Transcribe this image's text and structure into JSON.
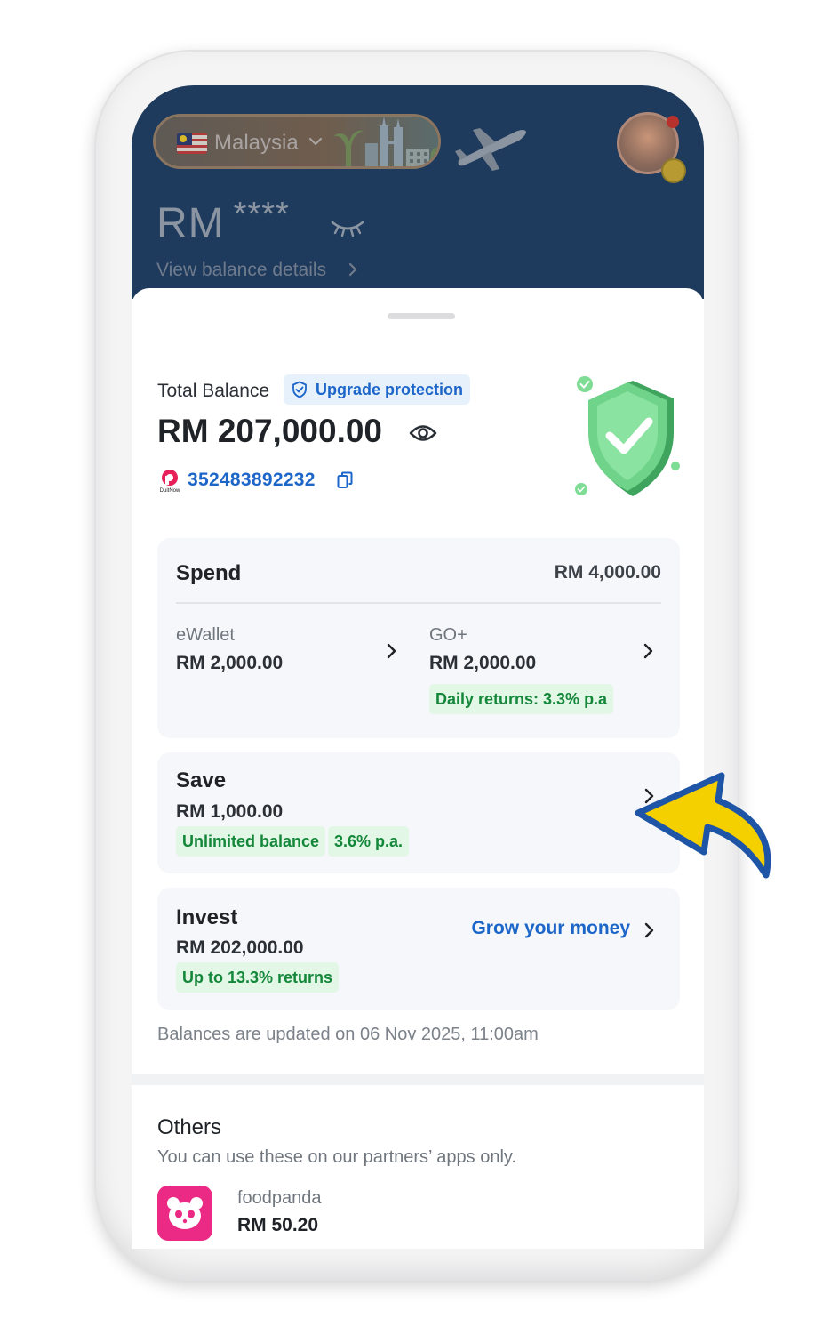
{
  "header": {
    "country": "Malaysia",
    "balance_currency": "RM",
    "balance_masked": "****",
    "view_balance_details": "View balance details"
  },
  "total": {
    "label": "Total Balance",
    "upgrade_label": "Upgrade protection",
    "value": "RM 207,000.00",
    "account_number": "352483892232",
    "duitnow_label": "DuitNow"
  },
  "spend": {
    "title": "Spend",
    "amount": "RM 4,000.00",
    "ewallet": {
      "label": "eWallet",
      "value": "RM 2,000.00"
    },
    "goplus": {
      "label": "GO+",
      "value": "RM 2,000.00",
      "tag": "Daily returns: 3.3% p.a"
    }
  },
  "save": {
    "title": "Save",
    "value": "RM 1,000.00",
    "tags": [
      "Unlimited balance",
      "3.6% p.a."
    ]
  },
  "invest": {
    "title": "Invest",
    "value": "RM 202,000.00",
    "tag": "Up to 13.3% returns",
    "cta": "Grow your money"
  },
  "updated_note": "Balances are updated on 06 Nov 2025, 11:00am",
  "others": {
    "title": "Others",
    "subtitle": "You can use these on our partners’ apps only.",
    "items": [
      {
        "name": "foodpanda",
        "value": "RM 50.20",
        "icon": "foodpanda-icon"
      }
    ]
  },
  "colors": {
    "header_bg": "#1e3a5c",
    "accent_blue": "#1d66c9",
    "tag_green_bg": "#e2f7e6",
    "tag_green_text": "#14873a",
    "foodpanda_pink": "#ea2a85",
    "annotation_arrow": "#f5d000"
  }
}
